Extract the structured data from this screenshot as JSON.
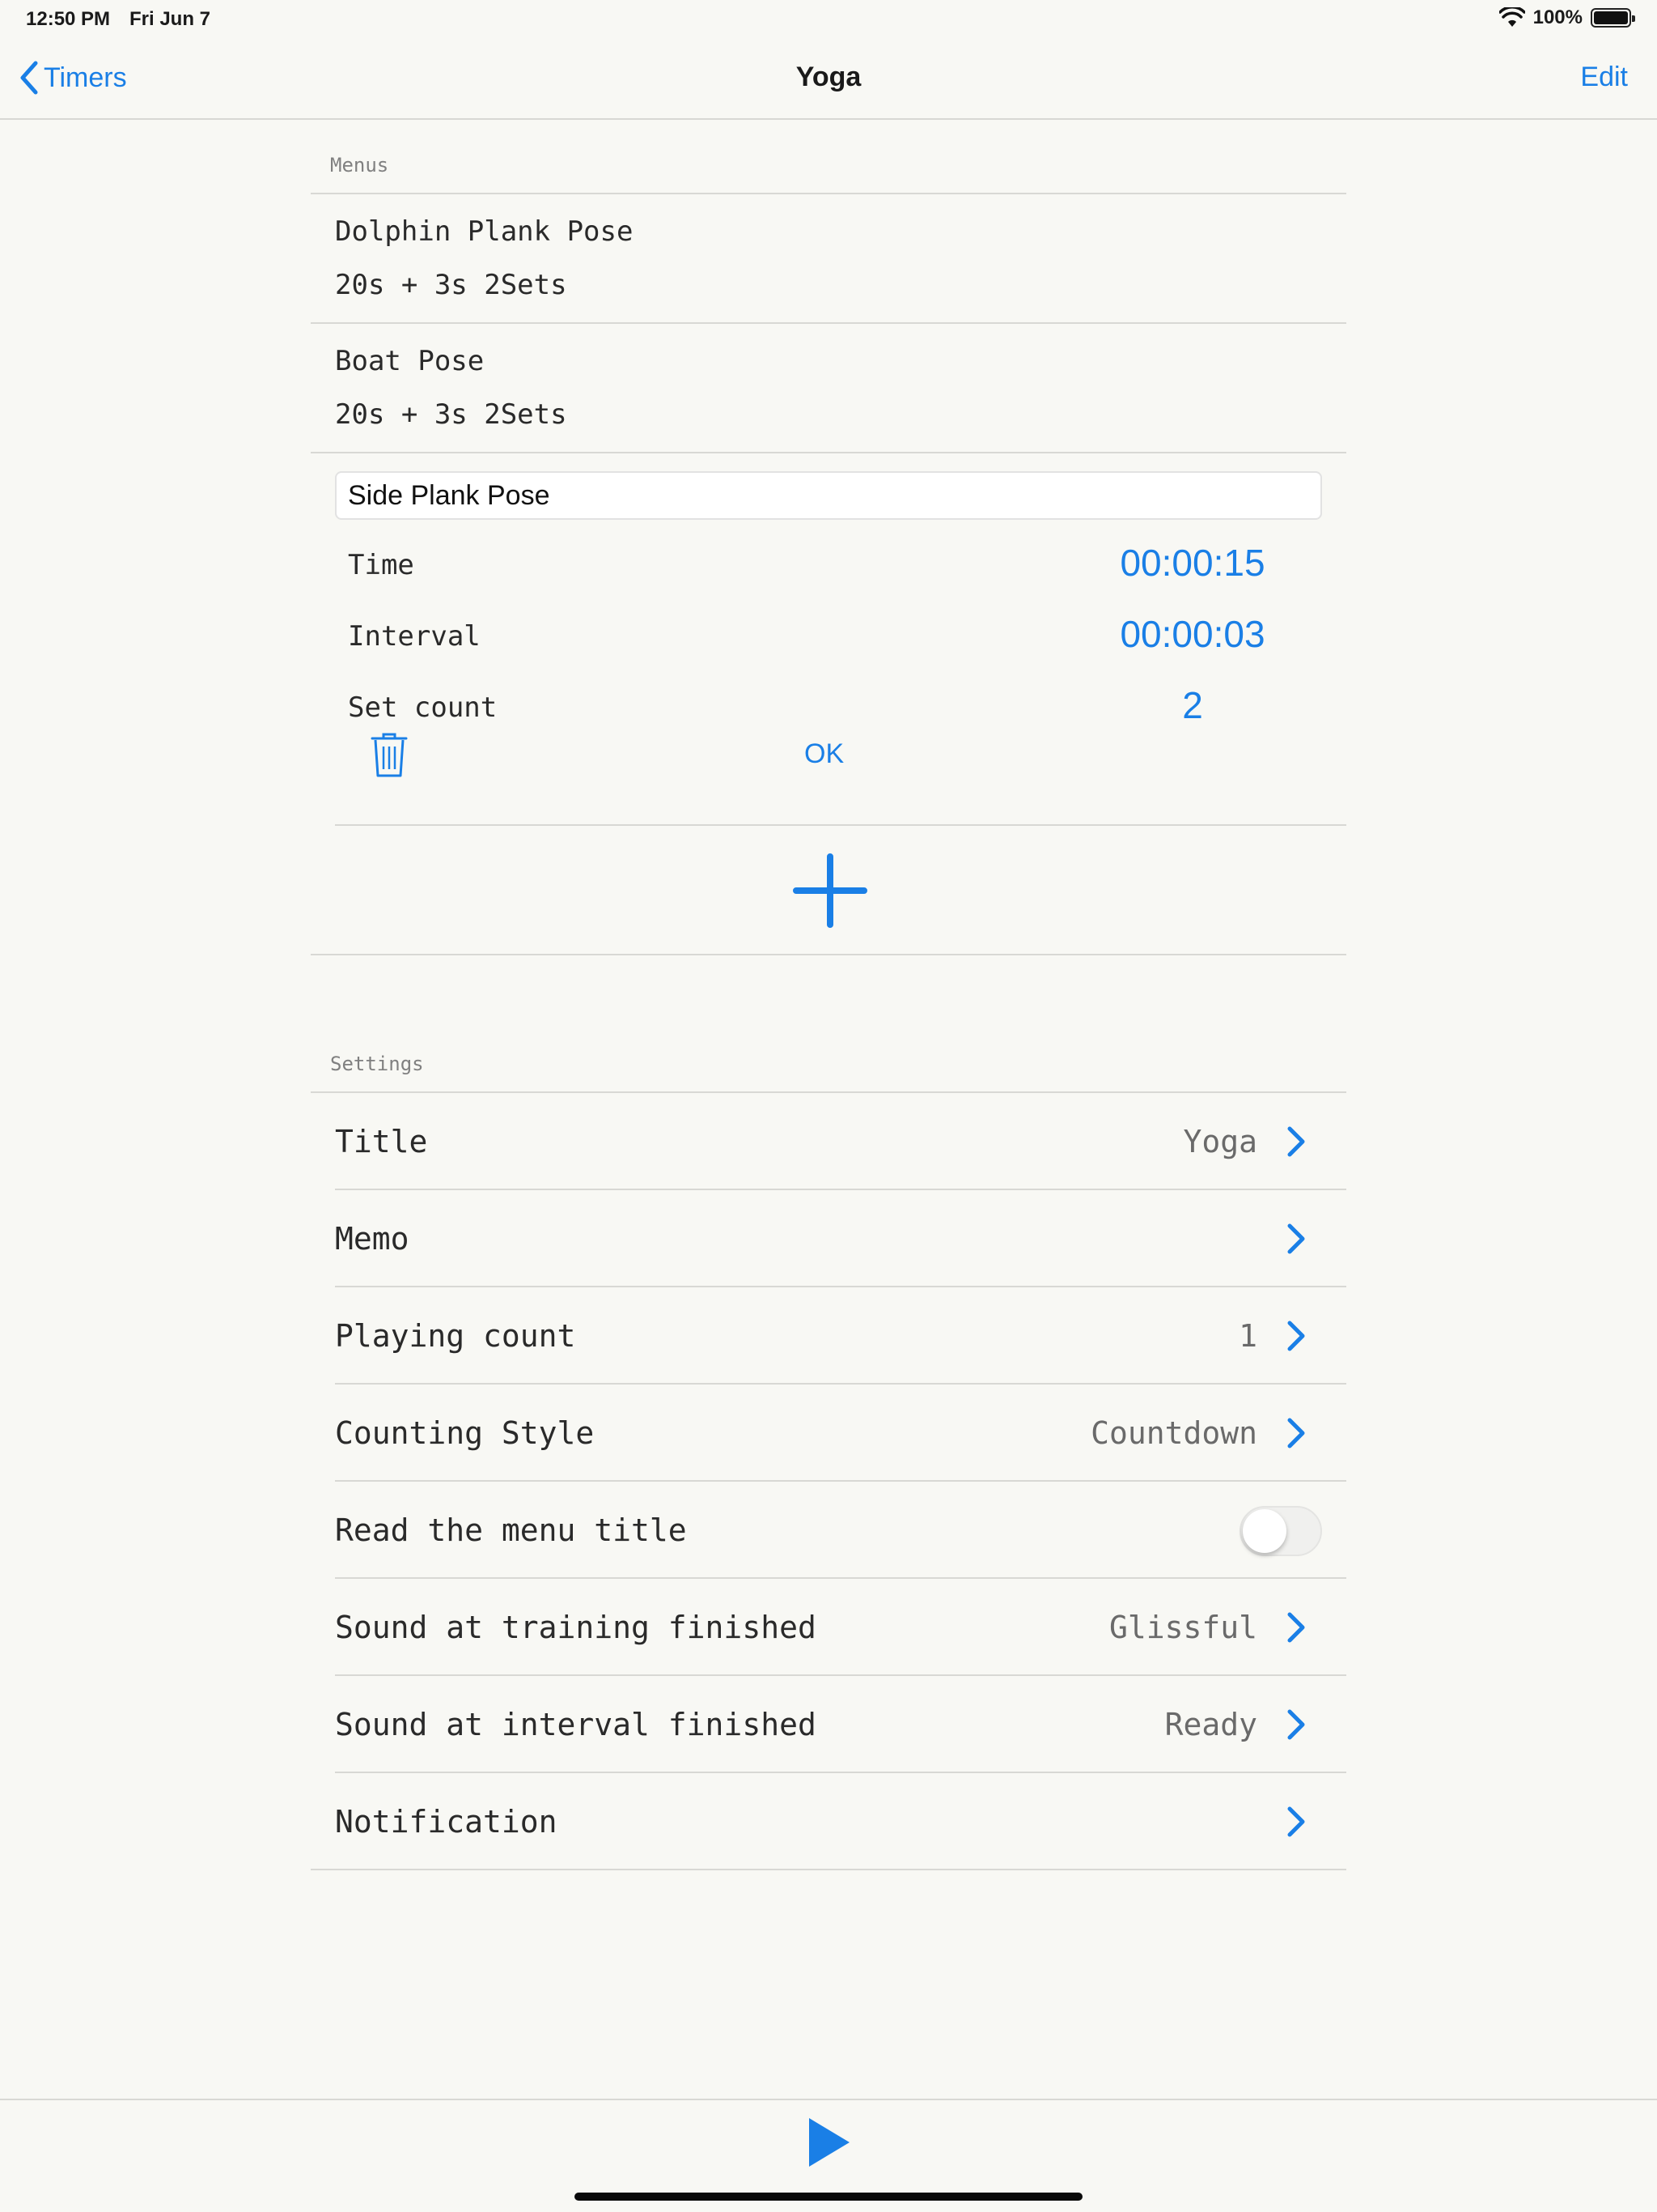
{
  "status_bar": {
    "time": "12:50 PM",
    "date": "Fri Jun 7",
    "battery_text": "100%"
  },
  "nav": {
    "back_label": "Timers",
    "title": "Yoga",
    "edit_label": "Edit"
  },
  "menus": {
    "header": "Menus",
    "items": [
      {
        "name": "Dolphin Plank Pose",
        "detail": "20s + 3s 2Sets"
      },
      {
        "name": "Boat Pose",
        "detail": "20s + 3s 2Sets"
      }
    ],
    "editing": {
      "name_value": "Side Plank Pose",
      "time_label": "Time",
      "time_value": "00:00:15",
      "interval_label": "Interval",
      "interval_value": "00:00:03",
      "set_count_label": "Set count",
      "set_count_value": "2",
      "ok_label": "OK"
    }
  },
  "settings": {
    "header": "Settings",
    "rows": [
      {
        "label": "Title",
        "value": "Yoga"
      },
      {
        "label": "Memo",
        "value": ""
      },
      {
        "label": "Playing count",
        "value": "1"
      },
      {
        "label": "Counting Style",
        "value": "Countdown"
      },
      {
        "label": "Read the menu title",
        "toggle": false
      },
      {
        "label": "Sound at training finished",
        "value": "Glissful"
      },
      {
        "label": "Sound at interval finished",
        "value": "Ready"
      },
      {
        "label": "Notification",
        "value": ""
      }
    ]
  },
  "colors": {
    "accent": "#1a7fe6",
    "background": "#f8f8f4",
    "separator": "#d8d8d4"
  }
}
